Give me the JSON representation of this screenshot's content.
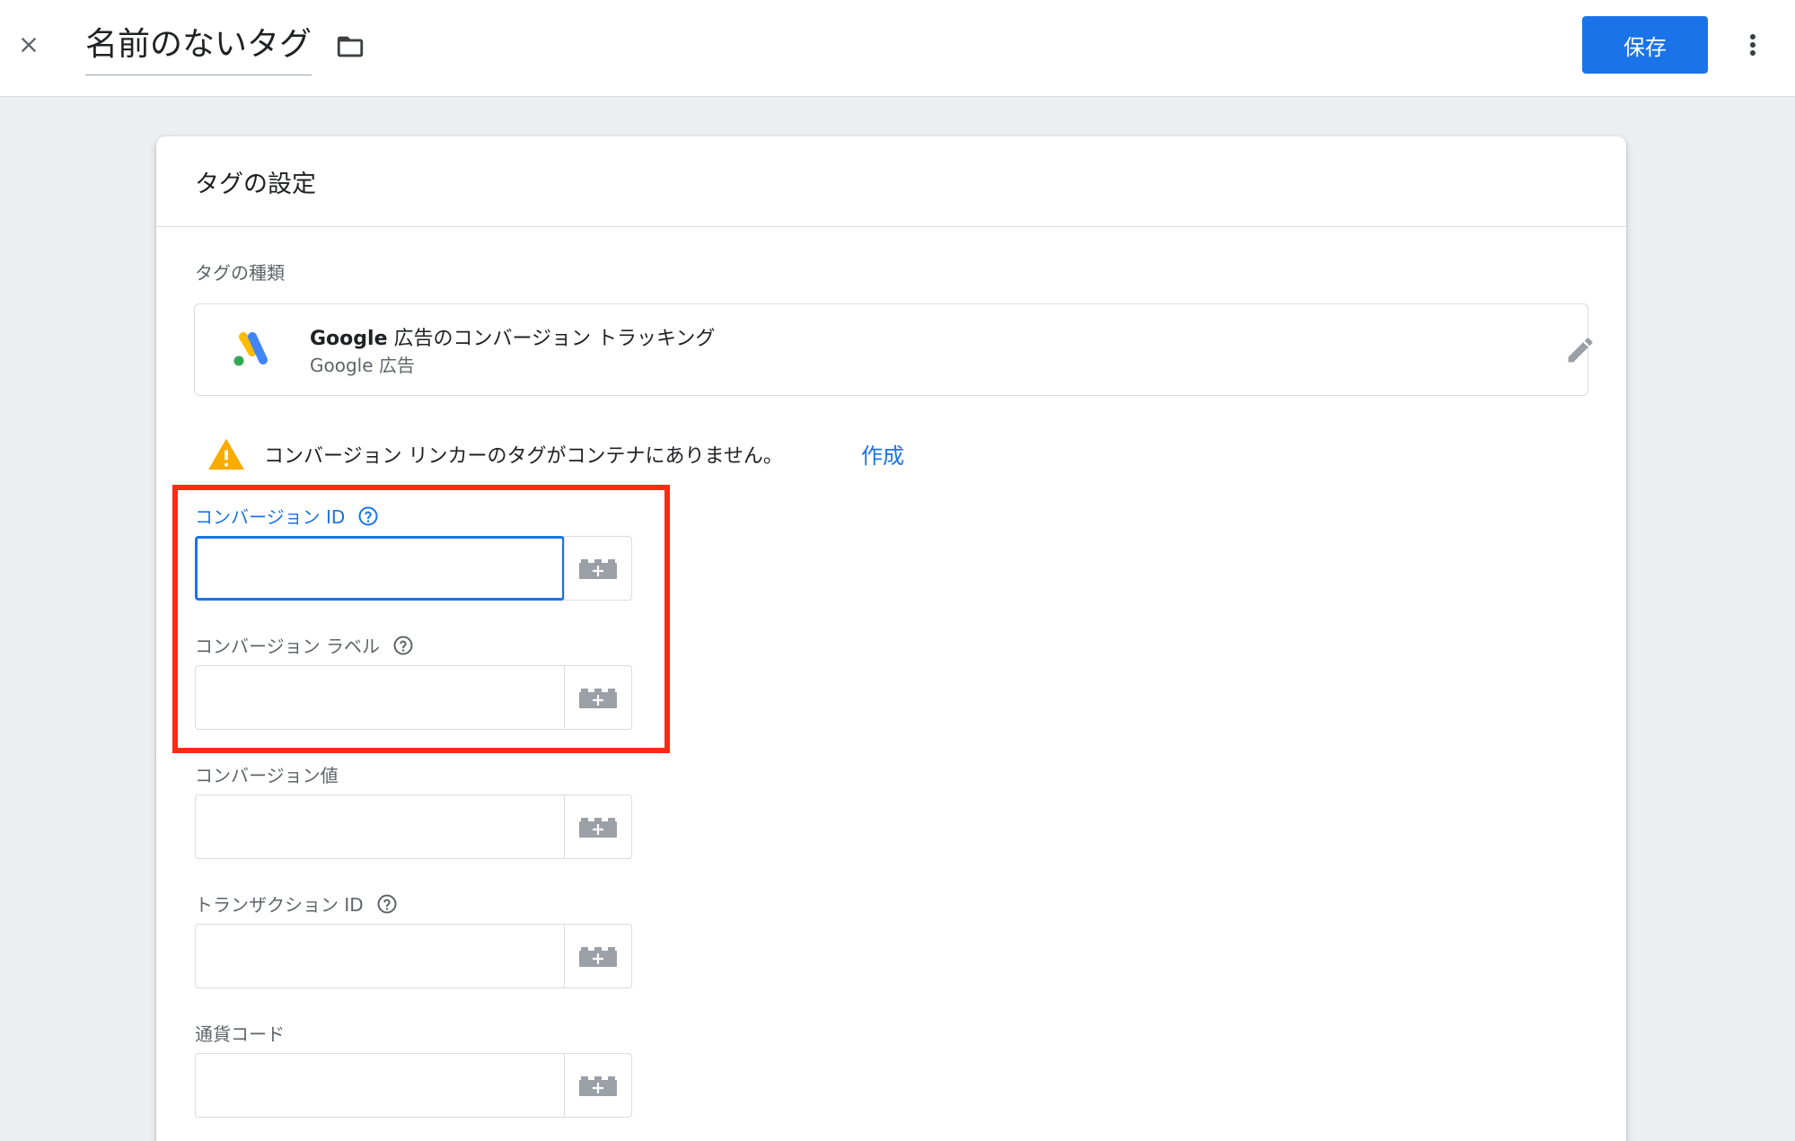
{
  "header": {
    "tag_name": "名前のないタグ",
    "save_label": "保存"
  },
  "card": {
    "title": "タグの設定",
    "tag_type_label": "タグの種類",
    "tag_type": {
      "name_brand": "Google",
      "name_rest": " 広告のコンバージョン トラッキング",
      "category": "Google 広告"
    },
    "warning": {
      "text": "コンバージョン リンカーのタグがコンテナにありません。",
      "action_label": "作成"
    },
    "fields": [
      {
        "label": "コンバージョン ID",
        "value": "",
        "has_help": true,
        "focused": true
      },
      {
        "label": "コンバージョン ラベル",
        "value": "",
        "has_help": true,
        "focused": false
      },
      {
        "label": "コンバージョン値",
        "value": "",
        "has_help": false,
        "focused": false
      },
      {
        "label": "トランザクション ID",
        "value": "",
        "has_help": true,
        "focused": false
      },
      {
        "label": "通貨コード",
        "value": "",
        "has_help": false,
        "focused": false
      }
    ]
  },
  "colors": {
    "accent": "#1a73e8",
    "highlight": "#ff2a12",
    "warning": "#f9ab00"
  }
}
